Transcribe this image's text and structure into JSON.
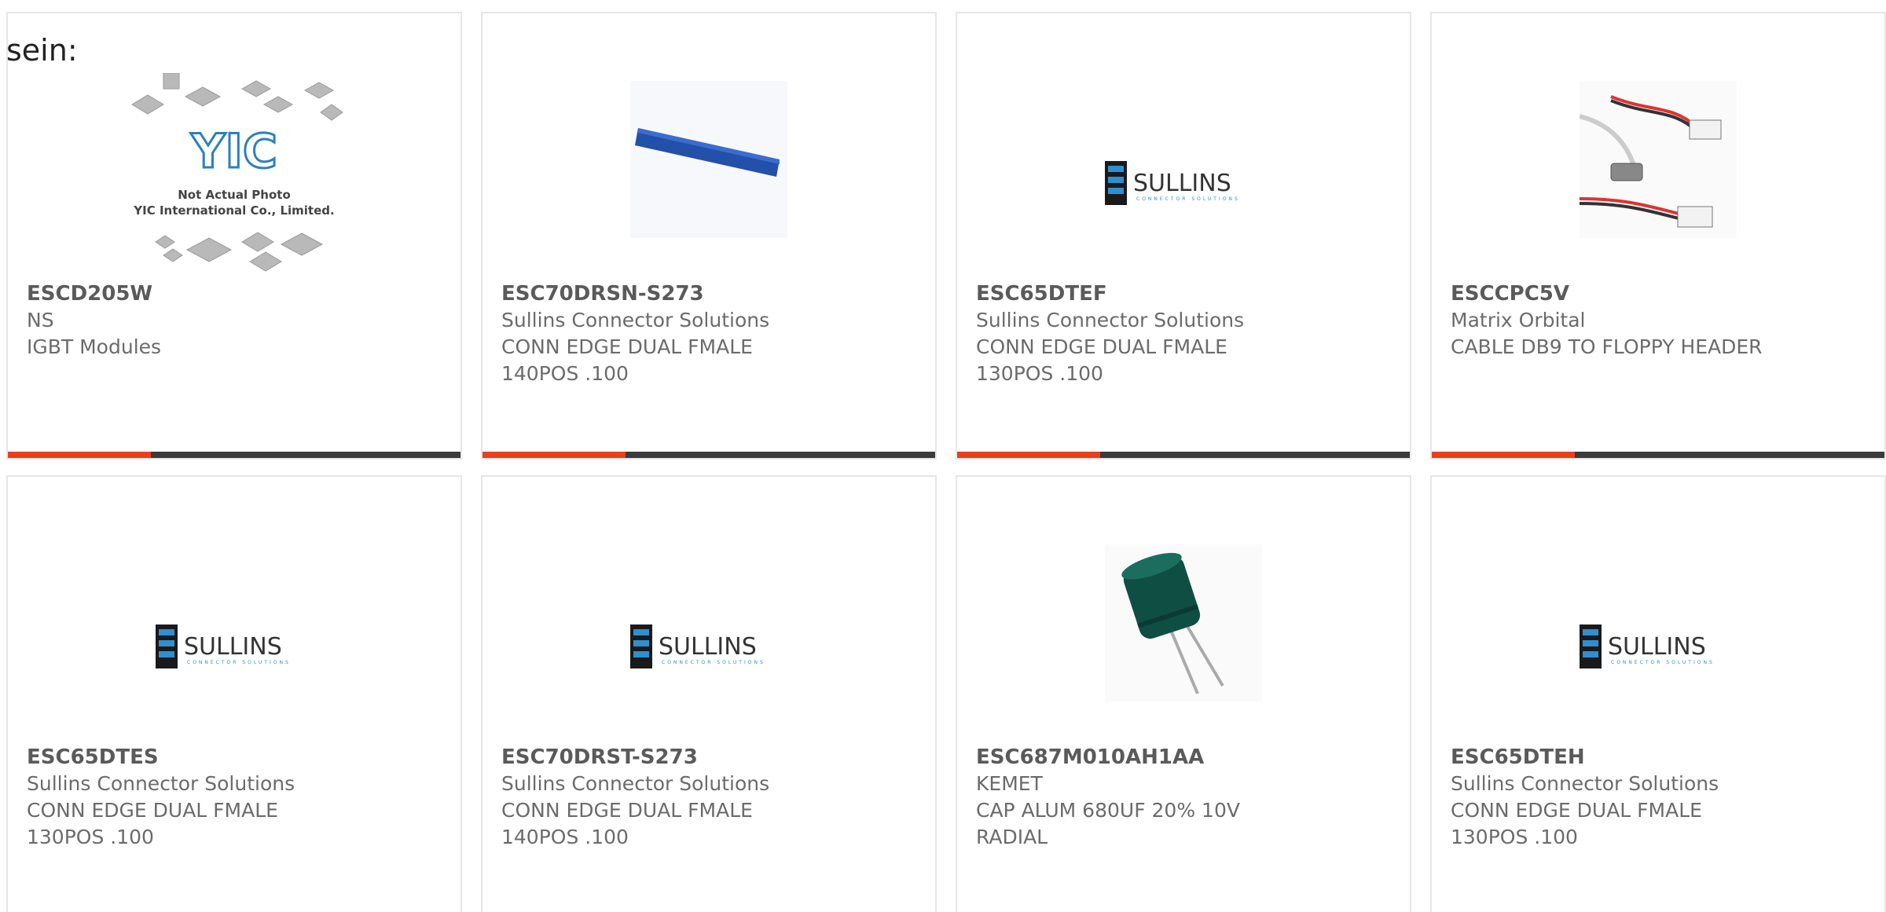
{
  "intro_text": "sein:",
  "colors": {
    "accent": "#e8401c",
    "bar": "#3b3b3b",
    "sullins_blue": "#1f5f8c"
  },
  "yic_image": {
    "line1": "Not Actual Photo",
    "line2": "YIC International Co., Limited."
  },
  "sullins_logo": {
    "word": "SULLINS",
    "tagline": "CONNECTOR SOLUTIONS"
  },
  "products": [
    {
      "part": "ESCD205W",
      "maker": "NS",
      "desc1": "IGBT Modules",
      "desc2": "",
      "image": "yic-placeholder-image"
    },
    {
      "part": "ESC70DRSN-S273",
      "maker": "Sullins Connector Solutions",
      "desc1": "CONN EDGE DUAL FMALE",
      "desc2": "140POS .100",
      "image": "blue-edge-connector-image"
    },
    {
      "part": "ESC65DTEF",
      "maker": "Sullins Connector Solutions",
      "desc1": "CONN EDGE DUAL FMALE",
      "desc2": "130POS .100",
      "image": "sullins-logo-image"
    },
    {
      "part": "ESCCPC5V",
      "maker": "Matrix Orbital",
      "desc1": "CABLE DB9 TO FLOPPY HEADER",
      "desc2": "",
      "image": "db9-cable-image"
    },
    {
      "part": "ESC65DTES",
      "maker": "Sullins Connector Solutions",
      "desc1": "CONN EDGE DUAL FMALE",
      "desc2": "130POS .100",
      "image": "sullins-logo-image"
    },
    {
      "part": "ESC70DRST-S273",
      "maker": "Sullins Connector Solutions",
      "desc1": "CONN EDGE DUAL FMALE",
      "desc2": "140POS .100",
      "image": "sullins-logo-image"
    },
    {
      "part": "ESC687M010AH1AA",
      "maker": "KEMET",
      "desc1": "CAP ALUM 680UF 20% 10V",
      "desc2": "RADIAL",
      "image": "capacitor-image"
    },
    {
      "part": "ESC65DTEH",
      "maker": "Sullins Connector Solutions",
      "desc1": "CONN EDGE DUAL FMALE",
      "desc2": "130POS .100",
      "image": "sullins-logo-image"
    }
  ]
}
